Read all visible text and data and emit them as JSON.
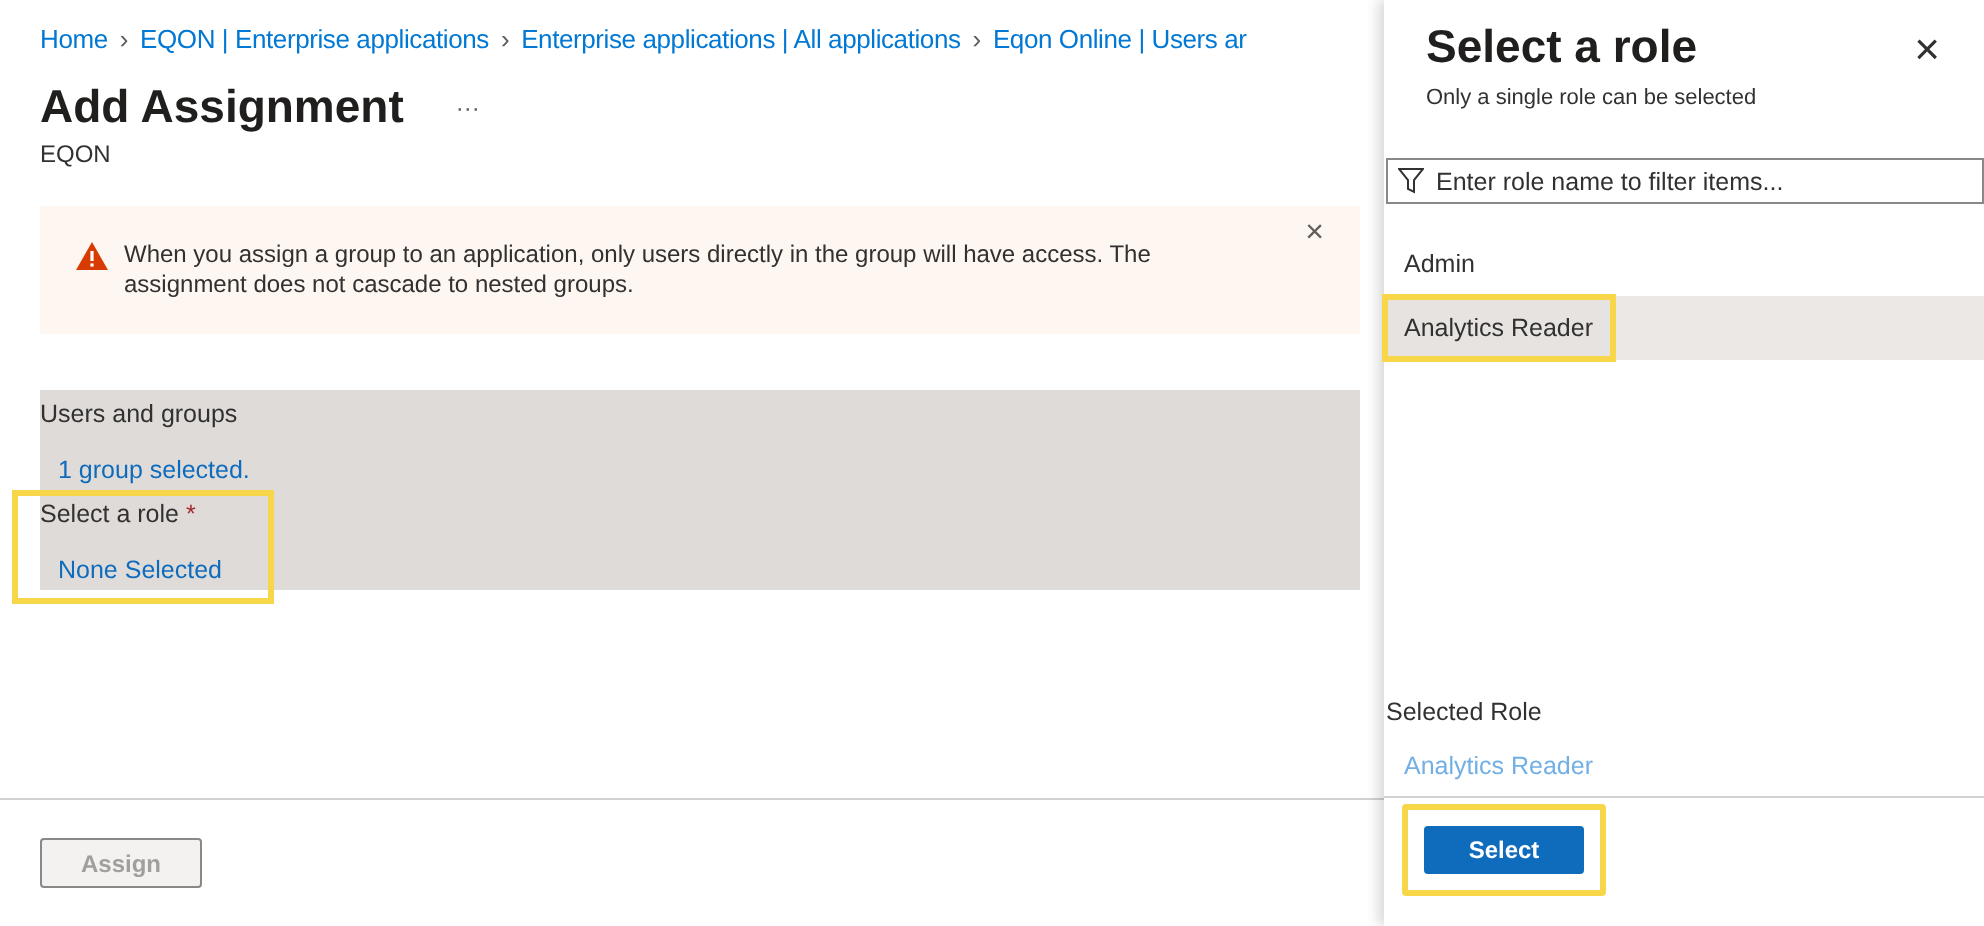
{
  "breadcrumb": [
    {
      "label": "Home",
      "separator": "›"
    },
    {
      "label": "EQON | Enterprise applications",
      "separator": "›"
    },
    {
      "label": "Enterprise applications | All applications",
      "separator": "›"
    },
    {
      "label": "Eqon Online | Users ar"
    }
  ],
  "page": {
    "title": "Add Assignment",
    "more": "···",
    "subtitle": "EQON"
  },
  "banner": {
    "kind": "warning",
    "text": "When you assign a group to an application, only users directly in the group will have access. The assignment does not cascade to nested groups.",
    "dismiss": "×"
  },
  "fields": [
    {
      "label": "Users and groups",
      "value": "1 group selected."
    },
    {
      "label": "Select a role",
      "required": true,
      "required_mark": "*",
      "value": "None Selected",
      "highlighted": true
    }
  ],
  "assign_button": {
    "label": "Assign",
    "disabled": true
  },
  "panel": {
    "title": "Select a role",
    "subtitle": "Only a single role can be selected",
    "close": "×",
    "filter": {
      "placeholder": "Enter role name to filter items..."
    },
    "roles": [
      {
        "name": "Admin",
        "selected": false,
        "highlighted": false
      },
      {
        "name": "Analytics Reader",
        "selected": true,
        "highlighted": true
      }
    ],
    "selected_role_label": "Selected Role",
    "selected_role": "Analytics Reader",
    "select_button": {
      "label": "Select",
      "highlighted": true
    }
  }
}
